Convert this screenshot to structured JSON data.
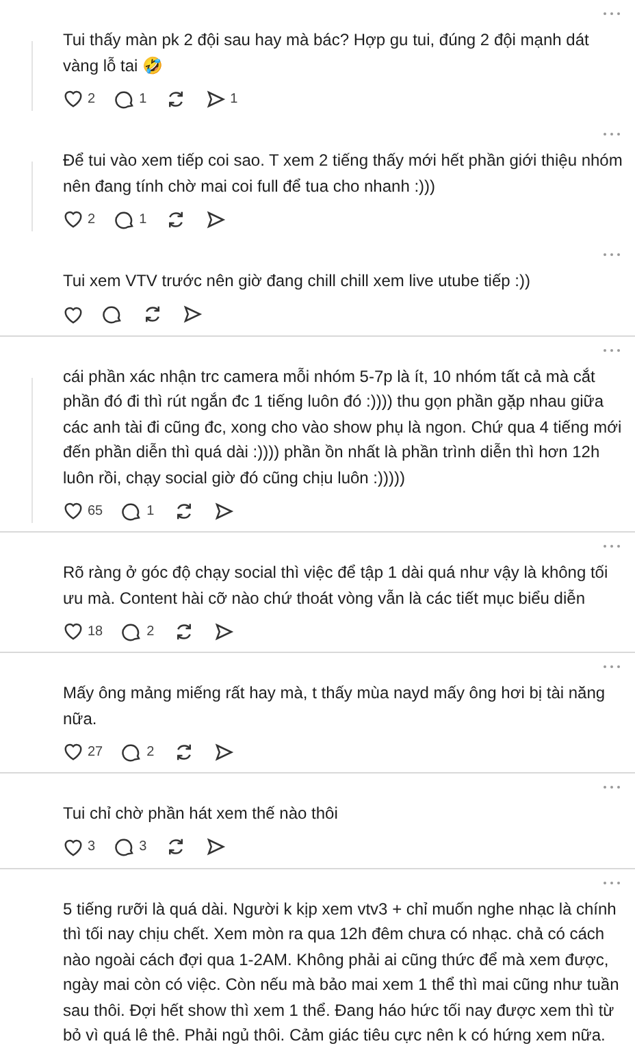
{
  "comments": [
    {
      "text": "Tui thấy màn pk 2 đội sau hay mà bác? Hợp gu tui, đúng 2 đội mạnh dát vàng lỗ tai 🤣",
      "threaded": true,
      "separator_below": false,
      "likes": "2",
      "replies": "1",
      "shares": "1"
    },
    {
      "text": "Để tui vào xem tiếp coi sao. T xem 2 tiếng thấy mới hết phần giới thiệu nhóm nên đang tính chờ mai coi full để tua cho nhanh :)))",
      "threaded": true,
      "separator_below": false,
      "likes": "2",
      "replies": "1"
    },
    {
      "text": "Tui xem VTV trước nên giờ đang chill chill xem live utube tiếp :))",
      "threaded": false,
      "separator_below": true
    },
    {
      "text": "cái phần xác nhận trc camera mỗi nhóm 5-7p là ít, 10 nhóm tất cả mà cắt phần đó đi thì rút ngắn đc 1 tiếng luôn đó :)))) thu gọn phần gặp nhau giữa các anh tài đi cũng đc, xong cho vào show phụ là ngon. Chứ qua 4 tiếng mới đến phần diễn thì quá dài :)))) phần ồn nhất là phần trình diễn thì hơn 12h luôn rồi, chạy social giờ đó cũng chịu luôn :)))))",
      "threaded": true,
      "separator_below": true,
      "likes": "65",
      "replies": "1"
    },
    {
      "text": "Rõ ràng ở góc độ chạy social thì việc để tập 1 dài quá như vậy là không tối ưu mà. Content hài cỡ nào chứ thoát vòng vẫn là các tiết mục biểu diễn",
      "threaded": false,
      "separator_below": true,
      "likes": "18",
      "replies": "2"
    },
    {
      "text": "Mấy ông mảng miếng rất hay mà, t thấy mùa nayd mấy ông hơi bị tài năng nữa.",
      "threaded": false,
      "separator_below": true,
      "likes": "27",
      "replies": "2"
    },
    {
      "text": "Tui chỉ chờ phần hát xem thế nào thôi",
      "threaded": false,
      "separator_below": true,
      "likes": "3",
      "replies": "3"
    },
    {
      "text": "5 tiếng rưỡi là quá dài. Người k kịp xem vtv3 + chỉ muốn nghe nhạc là chính thì tối nay chịu chết. Xem mòn ra qua 12h đêm chưa có nhạc. chả có cách nào ngoài cách đợi qua 1-2AM. Không phải ai cũng thức để mà xem được, ngày mai còn có việc. Còn nếu mà bảo mai xem 1 thể thì mai cũng như tuần sau thôi. Đợi hết show thì xem 1 thể. Đang háo hức tối nay được xem thì từ bỏ vì quá lê thê. Phải ngủ thôi. Cảm giác tiêu cực nên k có hứng xem nữa.",
      "threaded": false,
      "actions_hidden": true
    }
  ]
}
